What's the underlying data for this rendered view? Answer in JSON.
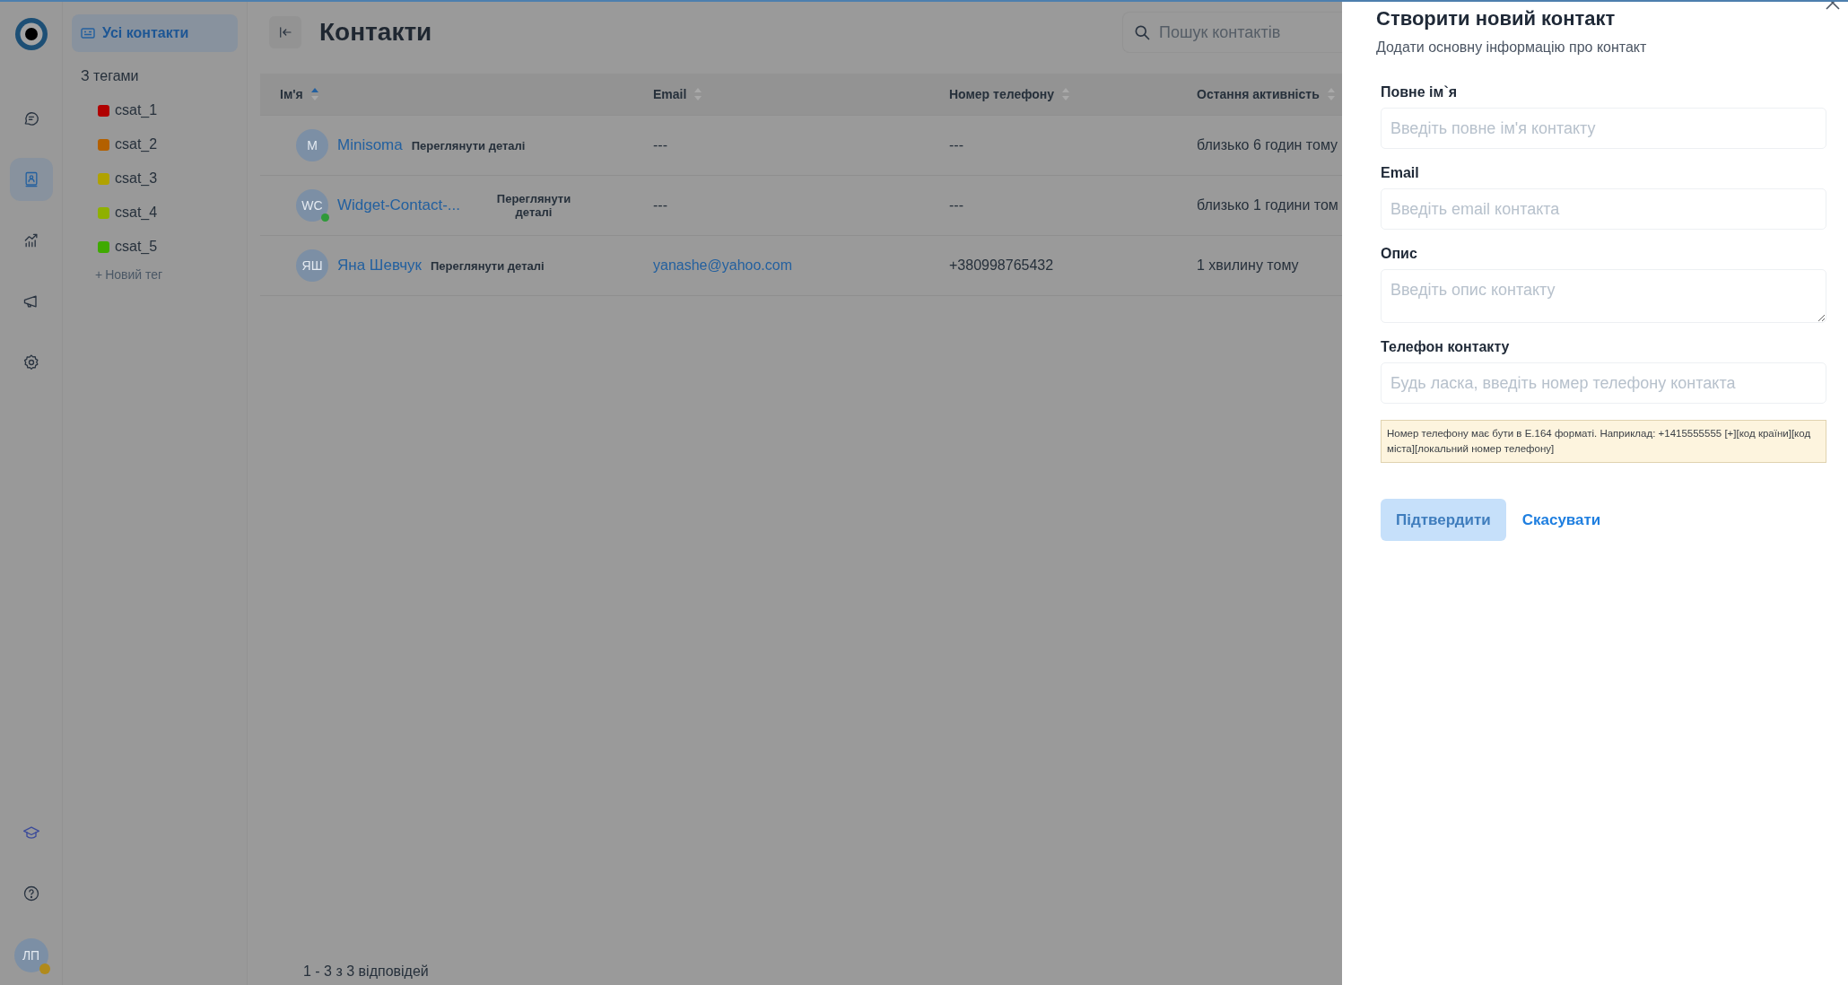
{
  "rail": {
    "items": [
      {
        "selected": false
      },
      {
        "selected": true
      },
      {
        "selected": false
      },
      {
        "selected": false
      },
      {
        "selected": false
      }
    ],
    "user": {
      "initials": "ЛП"
    }
  },
  "sidebar": {
    "all_contacts": {
      "label": "Усі контакти",
      "selected": true
    },
    "tags_heading": "З тегами",
    "tags": [
      {
        "label": "csat_1",
        "color": "#b00000"
      },
      {
        "label": "csat_2",
        "color": "#b36000"
      },
      {
        "label": "csat_3",
        "color": "#b0a200"
      },
      {
        "label": "csat_4",
        "color": "#8fb000"
      },
      {
        "label": "csat_5",
        "color": "#3faa00"
      }
    ],
    "new_tag": {
      "icon": "+",
      "label": "Новий тег"
    }
  },
  "header": {
    "title": "Контакти",
    "search": {
      "placeholder": "Пошук контактів"
    }
  },
  "table": {
    "columns": [
      {
        "label": "Ім'я",
        "sorted": true
      },
      {
        "label": "Email",
        "sorted": false
      },
      {
        "label": "Номер телефону",
        "sorted": false
      },
      {
        "label": "Остання активність",
        "sorted": false
      }
    ],
    "rows": [
      {
        "initials": "M",
        "online": false,
        "name": "Minisoma",
        "details": "Переглянути деталі",
        "wrap": false,
        "email": "---",
        "email_link": false,
        "phone": "---",
        "activity": "близько 6 годин тому"
      },
      {
        "initials": "WC",
        "online": true,
        "name": "Widget-Contact-...",
        "details": "Переглянути деталі",
        "wrap": true,
        "email": "---",
        "email_link": false,
        "phone": "---",
        "activity": "близько 1 години том"
      },
      {
        "initials": "ЯШ",
        "online": false,
        "name": "Яна Шевчук",
        "details": "Переглянути деталі",
        "wrap": false,
        "email": "yanashe@yahoo.com",
        "email_link": true,
        "phone": "+380998765432",
        "activity": "1 хвилину тому"
      }
    ]
  },
  "footer": "1 - 3 з 3 відповідей",
  "panel": {
    "title": "Створити новий контакт",
    "subtitle": "Додати основну інформацію про контакт",
    "fields": [
      {
        "label": "Повне ім`я",
        "placeholder": "Введіть повне ім'я контакту",
        "kind": "input"
      },
      {
        "label": "Email",
        "placeholder": "Введіть email контакта",
        "kind": "input"
      },
      {
        "label": "Опис",
        "placeholder": "Введіть опис контакту",
        "kind": "textarea"
      },
      {
        "label": "Телефон контакту",
        "placeholder": "Будь ласка, введіть номер телефону контакта",
        "kind": "input"
      }
    ],
    "hint": "Номер телефону має бути в E.164 форматі. Наприклад: +1415555555 [+][код країни][код міста][локальний номер телефону]",
    "submit": {
      "label": "Підтвердити",
      "disabled": true
    },
    "cancel": "Скасувати"
  }
}
